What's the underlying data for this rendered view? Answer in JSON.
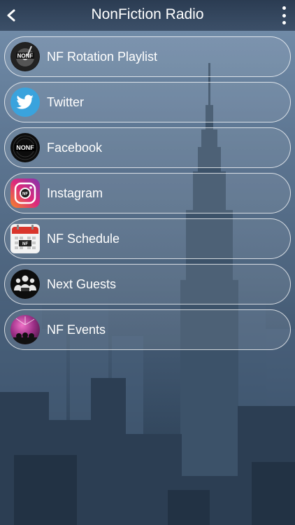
{
  "header": {
    "title": "NonFiction Radio"
  },
  "menu": {
    "items": [
      {
        "label": "NF Rotation Playlist",
        "icon": "turntable-logo-icon"
      },
      {
        "label": "Twitter",
        "icon": "twitter-bird-icon"
      },
      {
        "label": "Facebook",
        "icon": "nf-logo-icon"
      },
      {
        "label": "Instagram",
        "icon": "instagram-icon"
      },
      {
        "label": "NF Schedule",
        "icon": "calendar-icon"
      },
      {
        "label": "Next Guests",
        "icon": "guests-icon"
      },
      {
        "label": "NF Events",
        "icon": "events-icon"
      }
    ]
  },
  "colors": {
    "twitter": "#3aa3dd",
    "instagram_a": "#f58529",
    "instagram_b": "#c13584",
    "calendar_red": "#d9352c"
  }
}
